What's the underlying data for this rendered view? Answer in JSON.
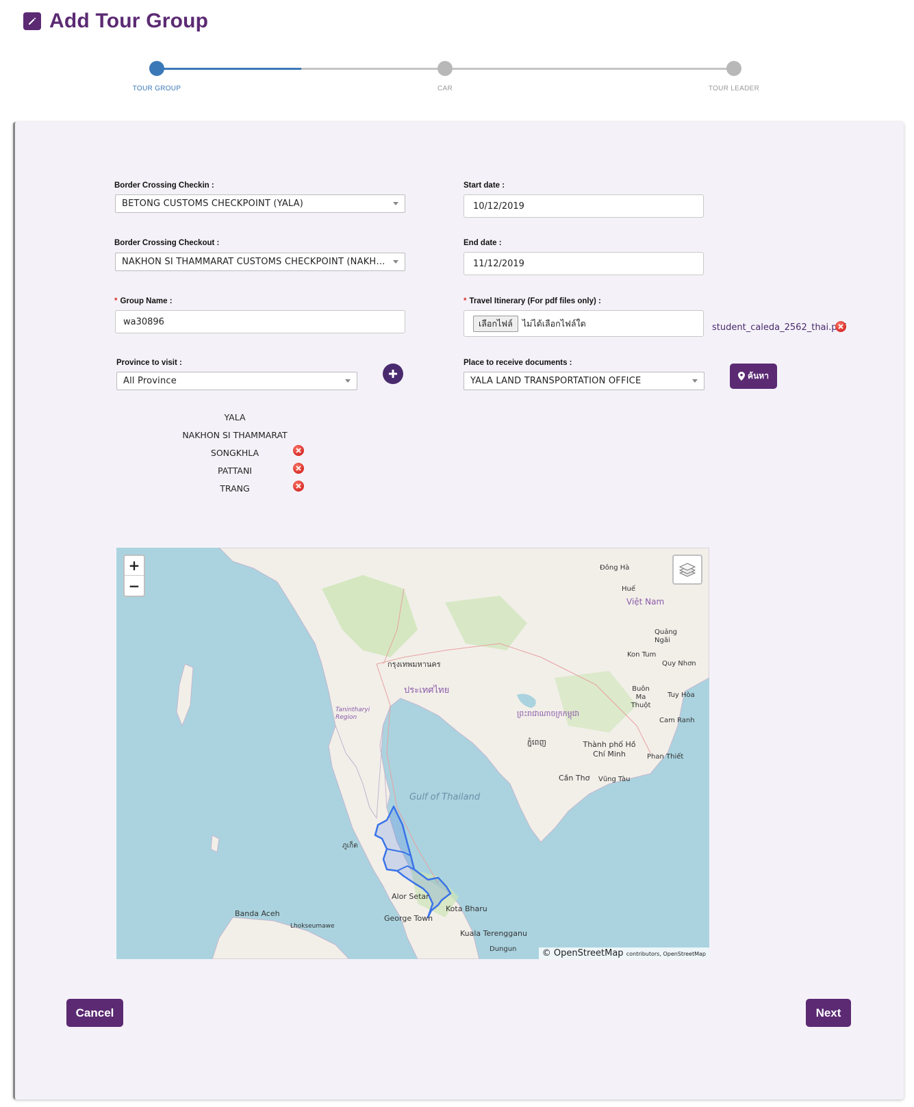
{
  "page": {
    "title": "Add Tour Group"
  },
  "stepper": {
    "steps": [
      {
        "label": "TOUR GROUP",
        "state": "active"
      },
      {
        "label": "CAR",
        "state": "inactive"
      },
      {
        "label": "TOUR LEADER",
        "state": "inactive"
      }
    ],
    "active_color": "#3a78b8",
    "inactive_color": "#b8b8b8"
  },
  "form": {
    "checkin": {
      "label": "Border Crossing Checkin :",
      "value": "BETONG CUSTOMS CHECKPOINT (YALA)"
    },
    "checkout": {
      "label": "Border Crossing Checkout :",
      "value": "NAKHON SI THAMMARAT CUSTOMS CHECKPOINT (NAKHON SI TH..."
    },
    "start_date": {
      "label": "Start date :",
      "value": "10/12/2019"
    },
    "end_date": {
      "label": "End date :",
      "value": "11/12/2019"
    },
    "group_name": {
      "required_mark": "*",
      "label": "Group Name :",
      "value": "wa30896"
    },
    "itinerary": {
      "required_mark": "*",
      "label": "Travel Itinerary (For pdf files only) :",
      "file_button": "เลือกไฟล์",
      "file_status": "ไม่ได้เลือกไฟล์ใด",
      "uploaded_file": "student_caleda_2562_thai.pdf"
    },
    "province": {
      "label": "Province to visit :",
      "value": "All Province"
    },
    "place": {
      "label": "Place to receive documents :",
      "value": "YALA LAND TRANSPORTATION OFFICE"
    },
    "search_button": "ค้นหา"
  },
  "provinces": [
    {
      "name": "YALA",
      "removable": false
    },
    {
      "name": "NAKHON SI THAMMARAT",
      "removable": false
    },
    {
      "name": "SONGKHLA",
      "removable": true
    },
    {
      "name": "PATTANI",
      "removable": true
    },
    {
      "name": "TRANG",
      "removable": true
    }
  ],
  "map": {
    "zoom_in": "+",
    "zoom_out": "−",
    "attribution": "OpenStreetMap",
    "attribution_small": "contributors, OpenStreetMap",
    "labels": {
      "gulf": "Gulf of Thailand",
      "bangkok": "กรุงเทพมหานคร",
      "vietnam": "Việt Nam",
      "hcm": "Thành phố Hồ Chí Minh",
      "can_tho": "Cần Thơ",
      "alor_setar": "Alor Setar",
      "george_town": "George Town",
      "kota_bharu": "Kota Bharu",
      "kuala_terengganu": "Kuala Terengganu",
      "banda_aceh": "Banda Aceh",
      "lhokseumawe": "Lhokseumawe",
      "dong_ha": "Đông Hà",
      "hue": "Huế",
      "quang_ngai": "Quảng Ngãi",
      "kon_tum": "Kon Tum",
      "quy_nhon": "Quy Nhơn",
      "buon_ma_thuot": "Buôn Ma Thuột",
      "tuy_hoa": "Tuy Hòa",
      "cam_ranh": "Cam Ranh",
      "phan_thiet": "Phan Thiết",
      "vung_tau": "Vũng Tàu",
      "phuket": "ภูเก็ต",
      "thailand": "ประเทศไทย",
      "cambodia": "ព្រះរាជាណាចក្រកម្ពុជា",
      "phnom_penh": "ភ្នំពេញ",
      "tanintharyi": "Tanintharyi Region",
      "dungun": "Dungun"
    }
  },
  "actions": {
    "cancel": "Cancel",
    "next": "Next"
  },
  "colors": {
    "brand": "#5b2a73",
    "danger": "#d9302c",
    "card_bg": "#f4f2f8",
    "map_water": "#aad3df",
    "map_land": "#f2efe9",
    "map_highlight": "#3a73e8"
  }
}
